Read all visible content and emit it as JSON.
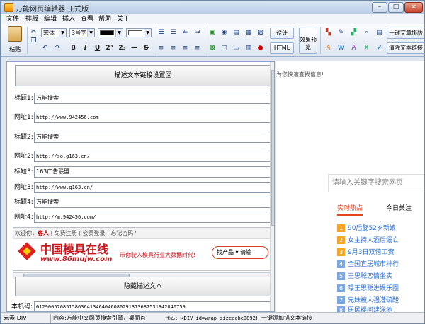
{
  "app": {
    "title": "万能网页编辑器 正式版"
  },
  "window_controls": {
    "minimize": "–",
    "maximize": "□",
    "close": "×"
  },
  "menu": [
    "文件",
    "排版",
    "编辑",
    "插入",
    "查看",
    "帮助",
    "关于"
  ],
  "toolbar": {
    "paste_label": "粘贴",
    "font_name": "宋体",
    "font_size": "3号字",
    "bold": "B",
    "italic": "I",
    "underline": "U",
    "superscript": "2³",
    "subscript": "2₃",
    "strike": "S",
    "design": "设计",
    "html": "HTML",
    "preview": "效果预览",
    "btn_links": "一键文章排版",
    "btn_clear": "清除文本链接",
    "colors": {
      "fore": "#000000",
      "back": "#ffffff"
    }
  },
  "panel": {
    "header_button": "描述文本链接设置区",
    "rows": [
      {
        "label": "标题1:",
        "value": "万能搜索",
        "mono": false
      },
      {
        "label": "网址1:",
        "value": "http://www.942456.com",
        "mono": true
      },
      {
        "label": "标题2:",
        "value": "万能搜索",
        "mono": false
      },
      {
        "label": "网址2:",
        "value": "http://so.g163.cn/",
        "mono": true
      },
      {
        "label": "标题3:",
        "value": "163广告联盟",
        "mono": false
      },
      {
        "label": "网址3:",
        "value": "http://www.g163.cn/",
        "mono": true
      },
      {
        "label": "标题4:",
        "value": "万能搜索",
        "mono": false
      },
      {
        "label": "网址4:",
        "value": "http://m.942456.com/",
        "mono": true
      }
    ],
    "preview": {
      "top_prefix": "欢迎你，",
      "top_user": "客人",
      "top_suffix": " | 免费注册 | 会员登录 | 忘记密码?",
      "brand": "中国模具在线",
      "url": "www.86mujw.com",
      "slogan": "带你驶入模具行业大数据时代!",
      "search": "找产品 ▾ 请输"
    },
    "hide_button": "隐藏描述文本",
    "machine_label": "本机码:",
    "machine_code": "61290057685158636413464046080291373687531342840759"
  },
  "right": {
    "hint": "为您快速查找信息!",
    "search_placeholder": "请输入关键字搜索网页",
    "tabs": [
      "实时热点",
      "今日关注"
    ],
    "news": [
      {
        "num": "1",
        "text": "90后娶52岁新娘"
      },
      {
        "num": "2",
        "text": "女主持人酒后溺亡"
      },
      {
        "num": "3",
        "text": "9月3日双倍工资"
      },
      {
        "num": "4",
        "text": "全国宜居城市排行"
      },
      {
        "num": "5",
        "text": "王思聪恋情坐实"
      },
      {
        "num": "6",
        "text": "曝王思聪进娱乐圈"
      },
      {
        "num": "7",
        "text": "兄妹被人强灌硫酸"
      },
      {
        "num": "8",
        "text": "居民楼间建泳池"
      }
    ]
  },
  "status": {
    "element": "元素:DIV",
    "content": "内容:万能中文网页搜索引擎，桌面首",
    "code": "代码: <DIV id=wrap sizcache0892f",
    "action": "一键添加描文本链接"
  }
}
